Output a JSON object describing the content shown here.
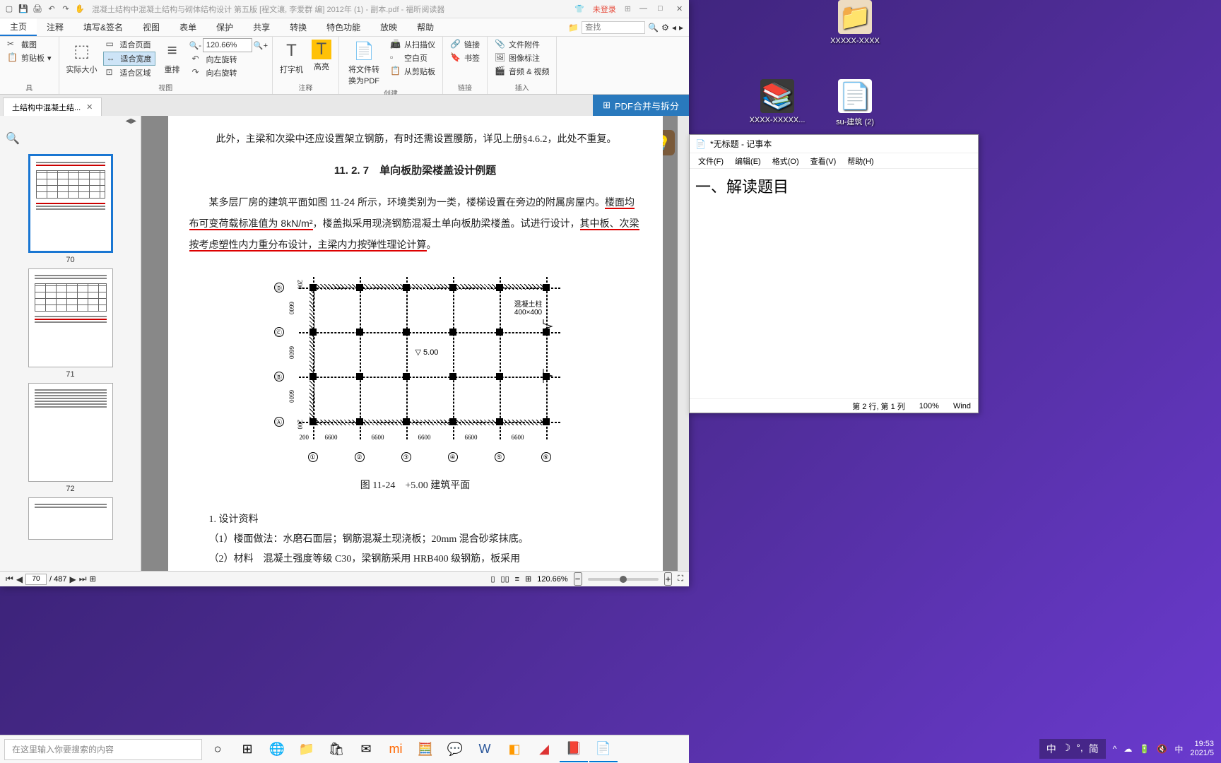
{
  "titlebar": {
    "title": "混凝土结构中混凝土结构与砌体结构设计 第五版 [程文瀼, 李爱群 编] 2012年 (1) - 副本.pdf - 福昕阅读器",
    "login": "未登录"
  },
  "ribbon": {
    "tabs": [
      "主页",
      "注释",
      "填写&签名",
      "视图",
      "表单",
      "保护",
      "共享",
      "转换",
      "特色功能",
      "放映",
      "帮助"
    ],
    "search_placeholder": "查找",
    "screenshot": "截图",
    "clipboard": "剪贴板",
    "actual_size": "实际大小",
    "fit_page": "适合页面",
    "fit_width": "适合宽度",
    "fit_visible": "适合区域",
    "reflow": "重排",
    "rotate_left": "向左旋转",
    "rotate_right": "向右旋转",
    "zoom_value": "120.66%",
    "group_view": "视图",
    "typewriter": "打字机",
    "highlight": "高亮",
    "group_annotate": "注释",
    "convert_to_pdf": "将文件转换为PDF",
    "from_scanner": "从扫描仪",
    "blank_page": "空白页",
    "from_clipboard": "从剪贴板",
    "group_create": "创建",
    "link": "链接",
    "bookmark": "书签",
    "group_link": "链接",
    "file_attachment": "文件附件",
    "image_annotation": "图像标注",
    "audio_video": "音频 & 视频",
    "group_insert": "插入"
  },
  "tab": {
    "name": "土结构中混凝土结...",
    "merge_split": "PDF合并与拆分"
  },
  "thumbs": {
    "p70": "70",
    "p71": "71",
    "p72": "72"
  },
  "doc": {
    "para_intro": "此外，主梁和次梁中还应设置架立钢筋，有时还需设置腰筋，详见上册§4.6.2，此处不重复。",
    "section_num": "11. 2. 7",
    "section_title": "单向板肋梁楼盖设计例题",
    "para2a": "某多层厂房的建筑平面如图 11-24 所示，环境类别为一类，楼梯设置在旁边的附属房屋内。",
    "para2b": "楼面均布可变荷载标准值为 8kN/m²",
    "para2c": "，楼盖拟采用现浇钢筋混凝土单向板肋梁楼盖。试进行设计，",
    "para2d": "其中板、次梁按考虑塑性内力重分布设计，",
    "para2e": "主梁内力按弹性理论计算",
    "para2f": "。",
    "column_label": "混凝土柱\n400×400",
    "elevation": "5.00",
    "span_h": "6600",
    "span_v": "6600",
    "edge_dim": "200",
    "axes_num": [
      "①",
      "②",
      "③",
      "④",
      "⑤",
      "⑥"
    ],
    "axes_let": [
      "Ⓐ",
      "Ⓑ",
      "Ⓒ",
      "Ⓓ"
    ],
    "fig_caption": "图 11-24　+5.00 建筑平面",
    "design_title": "1. 设计资料",
    "design_1": "（1）楼面做法：水磨石面层；钢筋混凝土现浇板；20mm 混合砂浆抹底。",
    "design_2": "（2）材料　混凝土强度等级 C30，梁钢筋采用 HRB400 级钢筋，板采用"
  },
  "status": {
    "current_page": "70",
    "total_pages": "/ 487",
    "zoom": "120.66%"
  },
  "notepad": {
    "title": "*无标题 - 记事本",
    "menu": [
      "文件(F)",
      "编辑(E)",
      "格式(O)",
      "查看(V)",
      "帮助(H)"
    ],
    "content": "一、解读题目",
    "status_pos": "第 2 行, 第 1 列",
    "status_zoom": "100%",
    "status_enc": "Wind"
  },
  "desktop": {
    "folder1": "XXXXX-XXXX",
    "folder2": "XXXX-XXXXX...",
    "file1": "su-建筑 (2)"
  },
  "taskbar": {
    "search_placeholder": "在这里输入你要搜索的内容",
    "time": "19:53",
    "date": "2021/5",
    "ime1": "中",
    "ime2": "简"
  }
}
